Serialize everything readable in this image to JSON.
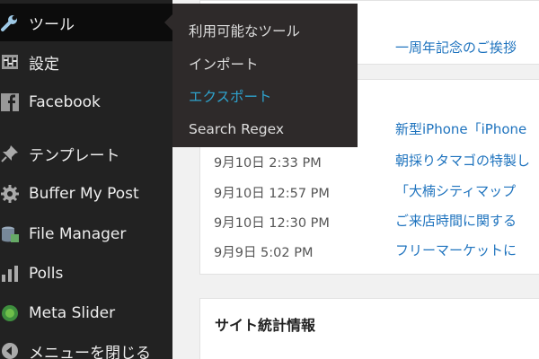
{
  "sidebar": {
    "items": [
      {
        "label": "ツール",
        "icon": "wrench-icon"
      },
      {
        "label": "設定",
        "icon": "settings-sliders-icon"
      },
      {
        "label": "Facebook",
        "icon": "facebook-icon"
      },
      {
        "label": "テンプレート",
        "icon": "pin-icon"
      },
      {
        "label": "Buffer My Post",
        "icon": "gear-icon"
      },
      {
        "label": "File Manager",
        "icon": "file-manager-icon"
      },
      {
        "label": "Polls",
        "icon": "bar-chart-icon"
      },
      {
        "label": "Meta Slider",
        "icon": "meta-slider-icon"
      },
      {
        "label": "メニューを閉じる",
        "icon": "collapse-arrow-icon"
      }
    ]
  },
  "flyout": {
    "items": [
      {
        "label": "利用可能なツール"
      },
      {
        "label": "インポート"
      },
      {
        "label": "エクスポート"
      },
      {
        "label": "Search Regex"
      }
    ]
  },
  "main": {
    "top_link": "一周年記念のご挨拶",
    "activity": [
      {
        "date": "",
        "title": "新型iPhone「iPhone"
      },
      {
        "date": "9月10日 2:33 PM",
        "title": "朝採りタマゴの特製し"
      },
      {
        "date": "9月10日 12:57 PM",
        "title": "「大楠シティマップ"
      },
      {
        "date": "9月10日 12:30 PM",
        "title": "ご来店時間に関する"
      },
      {
        "date": "9月9日 5:02 PM",
        "title": "フリーマーケットに"
      }
    ],
    "stats_title": "サイト統計情報"
  },
  "colors": {
    "sidebar_bg": "#222222",
    "flyout_bg": "#2e2a2a",
    "accent": "#2ea2cc",
    "link": "#1e73be"
  }
}
